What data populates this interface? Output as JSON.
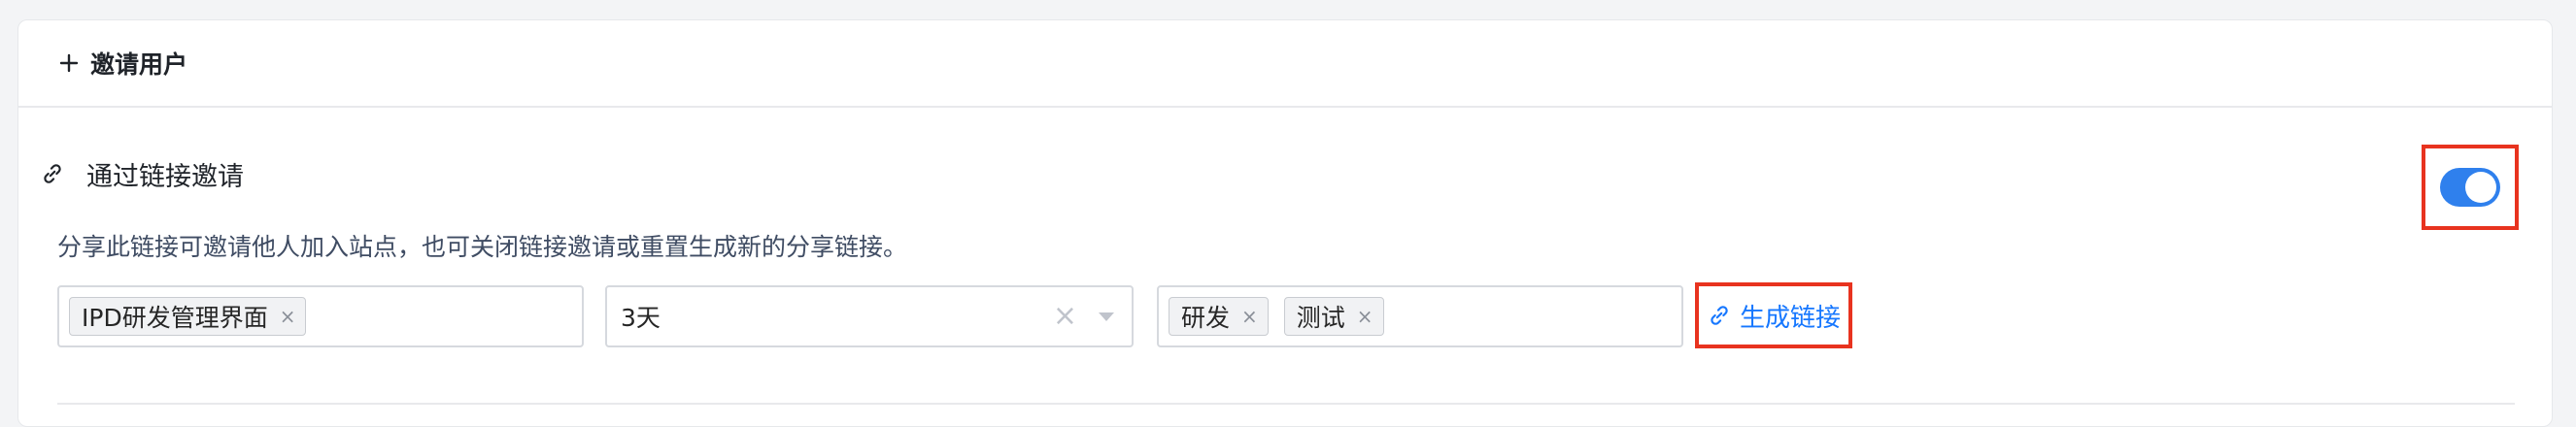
{
  "header": {
    "title": "邀请用户",
    "icon": "plus-icon"
  },
  "invite_link": {
    "title": "通过链接邀请",
    "icon": "link-icon",
    "description": "分享此链接可邀请他人加入站点，也可关闭链接邀请或重置生成新的分享链接。",
    "toggle": {
      "enabled": true,
      "color": "#2f80ed"
    }
  },
  "form": {
    "page_field": {
      "tags": [
        "IPD研发管理界面"
      ]
    },
    "expiry_select": {
      "value": "3天"
    },
    "group_field": {
      "tags": [
        "研发",
        "测试"
      ]
    },
    "generate_link_label": "生成链接"
  },
  "colors": {
    "accent": "#1677ff",
    "highlight_box": "#e8331f"
  }
}
